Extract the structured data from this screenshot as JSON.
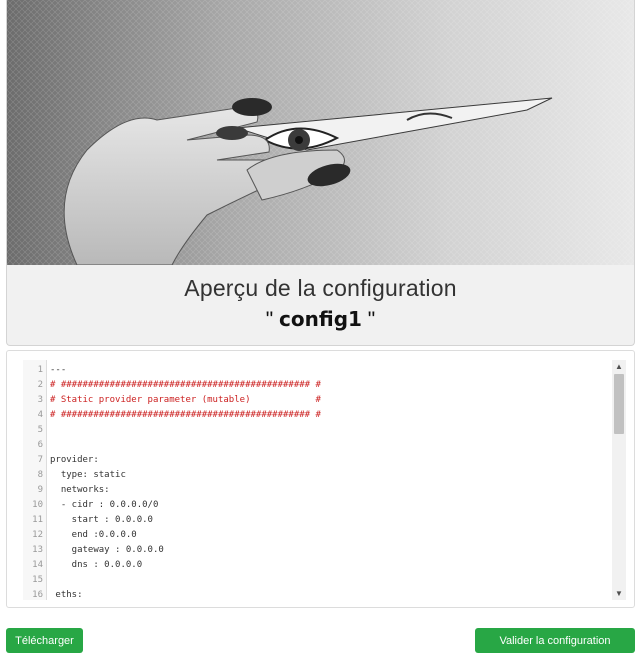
{
  "preview": {
    "title": "Aperçu de la configuration",
    "quote_open": "\"",
    "config_name": "config1",
    "quote_close": "\""
  },
  "editor": {
    "lines": [
      {
        "num": "1",
        "text": "---",
        "comment": false
      },
      {
        "num": "2",
        "text": "# ############################################## #",
        "comment": true
      },
      {
        "num": "3",
        "text": "# Static provider parameter (mutable)            #",
        "comment": true
      },
      {
        "num": "4",
        "text": "# ############################################## #",
        "comment": true
      },
      {
        "num": "5",
        "text": "",
        "comment": false
      },
      {
        "num": "6",
        "text": "",
        "comment": false
      },
      {
        "num": "7",
        "text": "provider:",
        "comment": false
      },
      {
        "num": "8",
        "text": "  type: static",
        "comment": false
      },
      {
        "num": "9",
        "text": "  networks:",
        "comment": false
      },
      {
        "num": "10",
        "text": "  - cidr : 0.0.0.0/0",
        "comment": false
      },
      {
        "num": "11",
        "text": "    start : 0.0.0.0",
        "comment": false
      },
      {
        "num": "12",
        "text": "    end :0.0.0.0",
        "comment": false
      },
      {
        "num": "13",
        "text": "    gateway : 0.0.0.0",
        "comment": false
      },
      {
        "num": "14",
        "text": "    dns : 0.0.0.0",
        "comment": false
      },
      {
        "num": "15",
        "text": "",
        "comment": false
      },
      {
        "num": "16",
        "text": " eths:",
        "comment": false
      }
    ],
    "scroll_up_icon": "▲",
    "scroll_down_icon": "▼"
  },
  "actions": {
    "download_label": "Télécharger",
    "validate_label": "Valider la configuration"
  },
  "colors": {
    "button": "#28a745",
    "comment": "#cc2222"
  }
}
